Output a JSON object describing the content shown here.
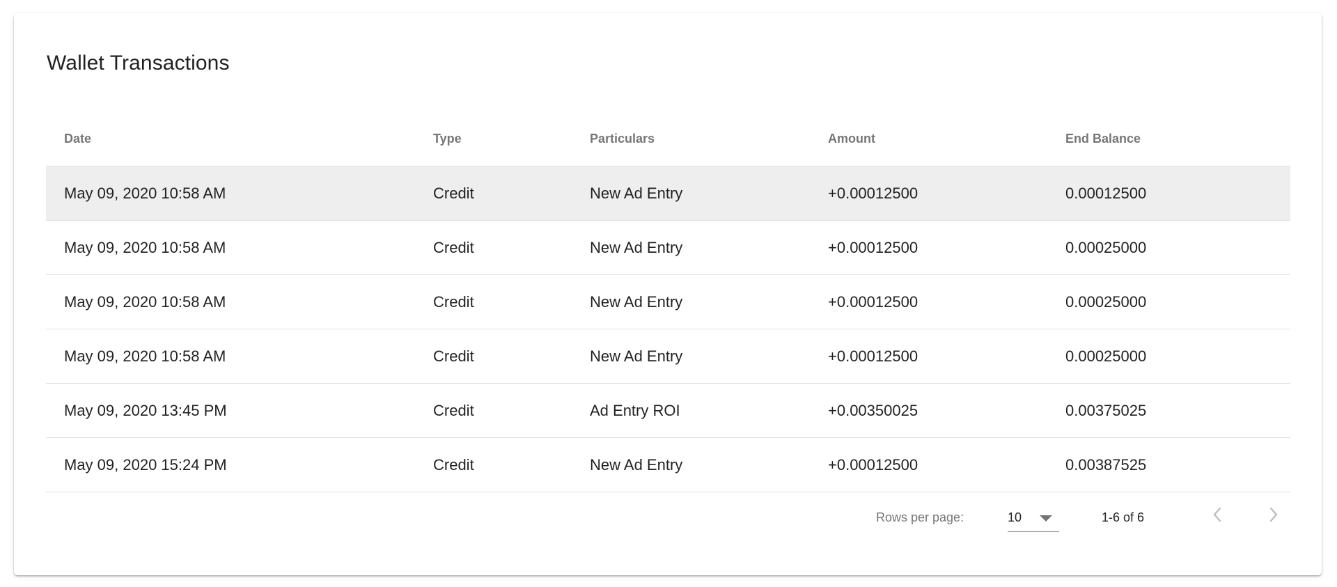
{
  "card": {
    "title": "Wallet Transactions"
  },
  "table": {
    "columns": [
      "Date",
      "Type",
      "Particulars",
      "Amount",
      "End Balance"
    ],
    "rows": [
      [
        "May 09, 2020 10:58 AM",
        "Credit",
        "New Ad Entry",
        "+0.00012500",
        "0.00012500"
      ],
      [
        "May 09, 2020 10:58 AM",
        "Credit",
        "New Ad Entry",
        "+0.00012500",
        "0.00025000"
      ],
      [
        "May 09, 2020 10:58 AM",
        "Credit",
        "New Ad Entry",
        "+0.00012500",
        "0.00025000"
      ],
      [
        "May 09, 2020 10:58 AM",
        "Credit",
        "New Ad Entry",
        "+0.00012500",
        "0.00025000"
      ],
      [
        "May 09, 2020 13:45 PM",
        "Credit",
        "Ad Entry ROI",
        "+0.00350025",
        "0.00375025"
      ],
      [
        "May 09, 2020 15:24 PM",
        "Credit",
        "New Ad Entry",
        "+0.00012500",
        "0.00387525"
      ]
    ],
    "hovered_row": 0
  },
  "pagination": {
    "rows_per_page_label": "Rows per page:",
    "rows_per_page_value": "10",
    "range_text": "1-6 of 6",
    "prev_icon": "chevron-left-icon",
    "next_icon": "chevron-right-icon"
  },
  "colors": {
    "hover_row": "#eeeeee",
    "divider": "#e0e0e0",
    "disabled_icon": "#bdbdbd"
  }
}
